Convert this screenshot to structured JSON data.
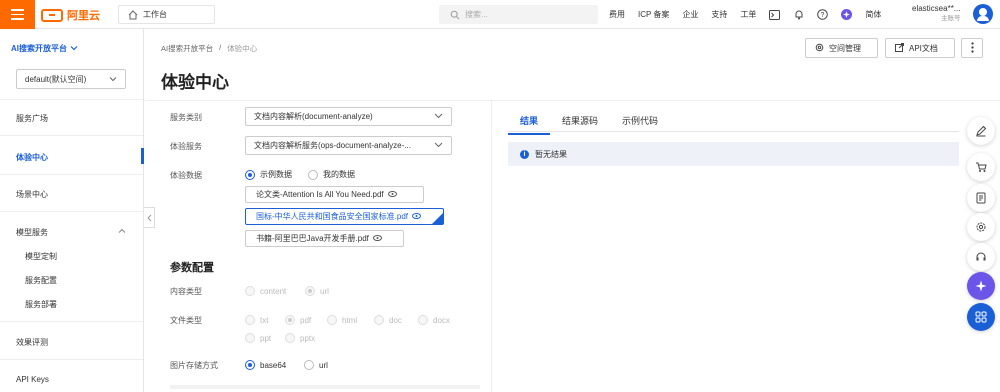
{
  "topbar": {
    "logo_text": "阿里云",
    "workbench": "工作台",
    "search_placeholder": "搜索...",
    "nav": [
      "费用",
      "ICP 备案",
      "企业",
      "支持",
      "工单"
    ],
    "lang": "简体",
    "user_name": "elasticsea**...",
    "user_role": "主账号"
  },
  "sidebar": {
    "platform": "AI搜索开放平台",
    "workspace": "default(默认空间)",
    "items": {
      "service_square": "服务广场",
      "experience": "体验中心",
      "scenario": "场景中心",
      "model_service": "模型服务",
      "model_custom": "模型定制",
      "service_config": "服务配置",
      "service_deploy": "服务部署",
      "eval": "效果评测",
      "api_keys": "API Keys"
    }
  },
  "header": {
    "breadcrumb_root": "AI搜索开放平台",
    "breadcrumb_sep": "/",
    "breadcrumb_current": "体验中心",
    "title": "体验中心",
    "space_btn": "空间管理",
    "api_btn": "API文档"
  },
  "form": {
    "category_label": "服务类别",
    "category_value": "文档内容解析(document-analyze)",
    "service_label": "体验服务",
    "service_value": "文档内容解析服务(ops-document-analyze-...",
    "data_label": "体验数据",
    "data_options": [
      "示例数据",
      "我的数据"
    ],
    "files": [
      "论文类-Attention Is All You Need.pdf",
      "国标-中华人民共和国食品安全国家标准.pdf",
      "书籍-阿里巴巴Java开发手册.pdf"
    ],
    "params_title": "参数配置",
    "content_type_label": "内容类型",
    "content_type_options": [
      "content",
      "url"
    ],
    "file_type_label": "文件类型",
    "file_type_options": [
      "txt",
      "pdf",
      "html",
      "doc",
      "docx",
      "ppt",
      "pptx"
    ],
    "img_store_label": "图片存储方式",
    "img_store_options": [
      "base64",
      "url"
    ]
  },
  "results": {
    "tabs": [
      "结果",
      "结果源码",
      "示例代码"
    ],
    "empty": "暂无结果"
  },
  "colors": {
    "brand": "#ff6a00",
    "accent": "#1b5fd6"
  }
}
